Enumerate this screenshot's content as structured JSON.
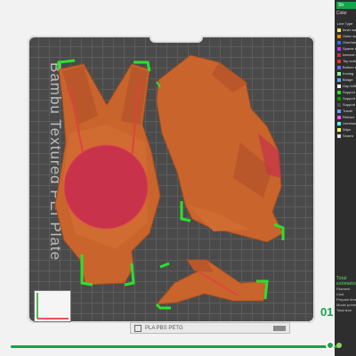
{
  "app": {
    "panel_tab_label": "Sh",
    "panel_header": "Color"
  },
  "plate": {
    "label": "Bambu Textured PEI Plate",
    "tag_text": "PLA PBS PETG"
  },
  "legend": {
    "title": "Line Type",
    "items": [
      {
        "label": "Inner wall",
        "color": "#ffe066"
      },
      {
        "label": "Outer wall",
        "color": "#ff8a00"
      },
      {
        "label": "Overhang wall",
        "color": "#2b6fff"
      },
      {
        "label": "Sparse infill",
        "color": "#b23cff"
      },
      {
        "label": "Internal solid infill",
        "color": "#c8324a"
      },
      {
        "label": "Top surface",
        "color": "#ff2d2d"
      },
      {
        "label": "Bottom surface",
        "color": "#6b6bff"
      },
      {
        "label": "Ironing",
        "color": "#8cff8c"
      },
      {
        "label": "Bridge",
        "color": "#59a9ff"
      },
      {
        "label": "Gap infill",
        "color": "#ffffff"
      },
      {
        "label": "Support",
        "color": "#2de02d"
      },
      {
        "label": "Support interface",
        "color": "#00a000"
      },
      {
        "label": "Support transition",
        "color": "#4d4d4d"
      },
      {
        "label": "Travel",
        "color": "#55aaff"
      },
      {
        "label": "Retract",
        "color": "#ff55ff"
      },
      {
        "label": "Unretract",
        "color": "#55ffff"
      },
      {
        "label": "Wipe",
        "color": "#ffff55"
      },
      {
        "label": "Seams",
        "color": "#e0e0e0"
      }
    ]
  },
  "stats": {
    "title": "Total estimation",
    "rows": [
      "Filament",
      "Cost",
      "Prepare time",
      "Model printing",
      "Total time"
    ]
  },
  "layer": {
    "current": "01",
    "progress": 1.0
  },
  "colors": {
    "accent": "#17a34a",
    "model": "#c9642c",
    "plate": "#4a4a4a"
  }
}
